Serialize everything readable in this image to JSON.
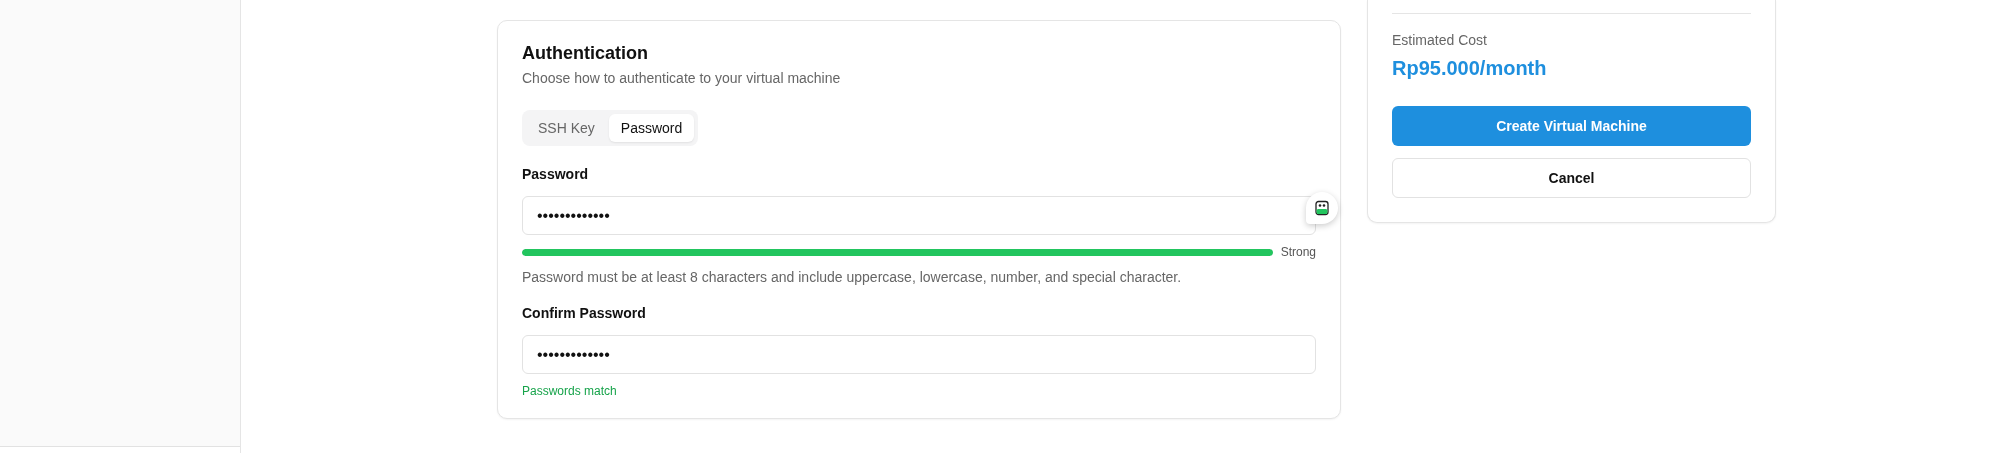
{
  "auth": {
    "title": "Authentication",
    "subtitle": "Choose how to authenticate to your virtual machine",
    "tabs": [
      {
        "label": "SSH Key",
        "selected": false
      },
      {
        "label": "Password",
        "selected": true
      }
    ],
    "password": {
      "label": "Password",
      "value": "•••••••••••••",
      "strength": {
        "level": 1,
        "reading": "Strong"
      },
      "hint": "Password must be at least 8 characters and include uppercase, lowercase, number, and special character."
    },
    "confirm": {
      "label": "Confirm Password",
      "value": "•••••••••••••",
      "message": "Passwords match",
      "match": true
    }
  },
  "summary": {
    "cost_label": "Estimated Cost",
    "cost": "Rp95.000/month",
    "buttons": [
      {
        "label": "Create Virtual Machine",
        "kind": "primary"
      },
      {
        "label": "Cancel",
        "kind": "secondary"
      }
    ]
  }
}
